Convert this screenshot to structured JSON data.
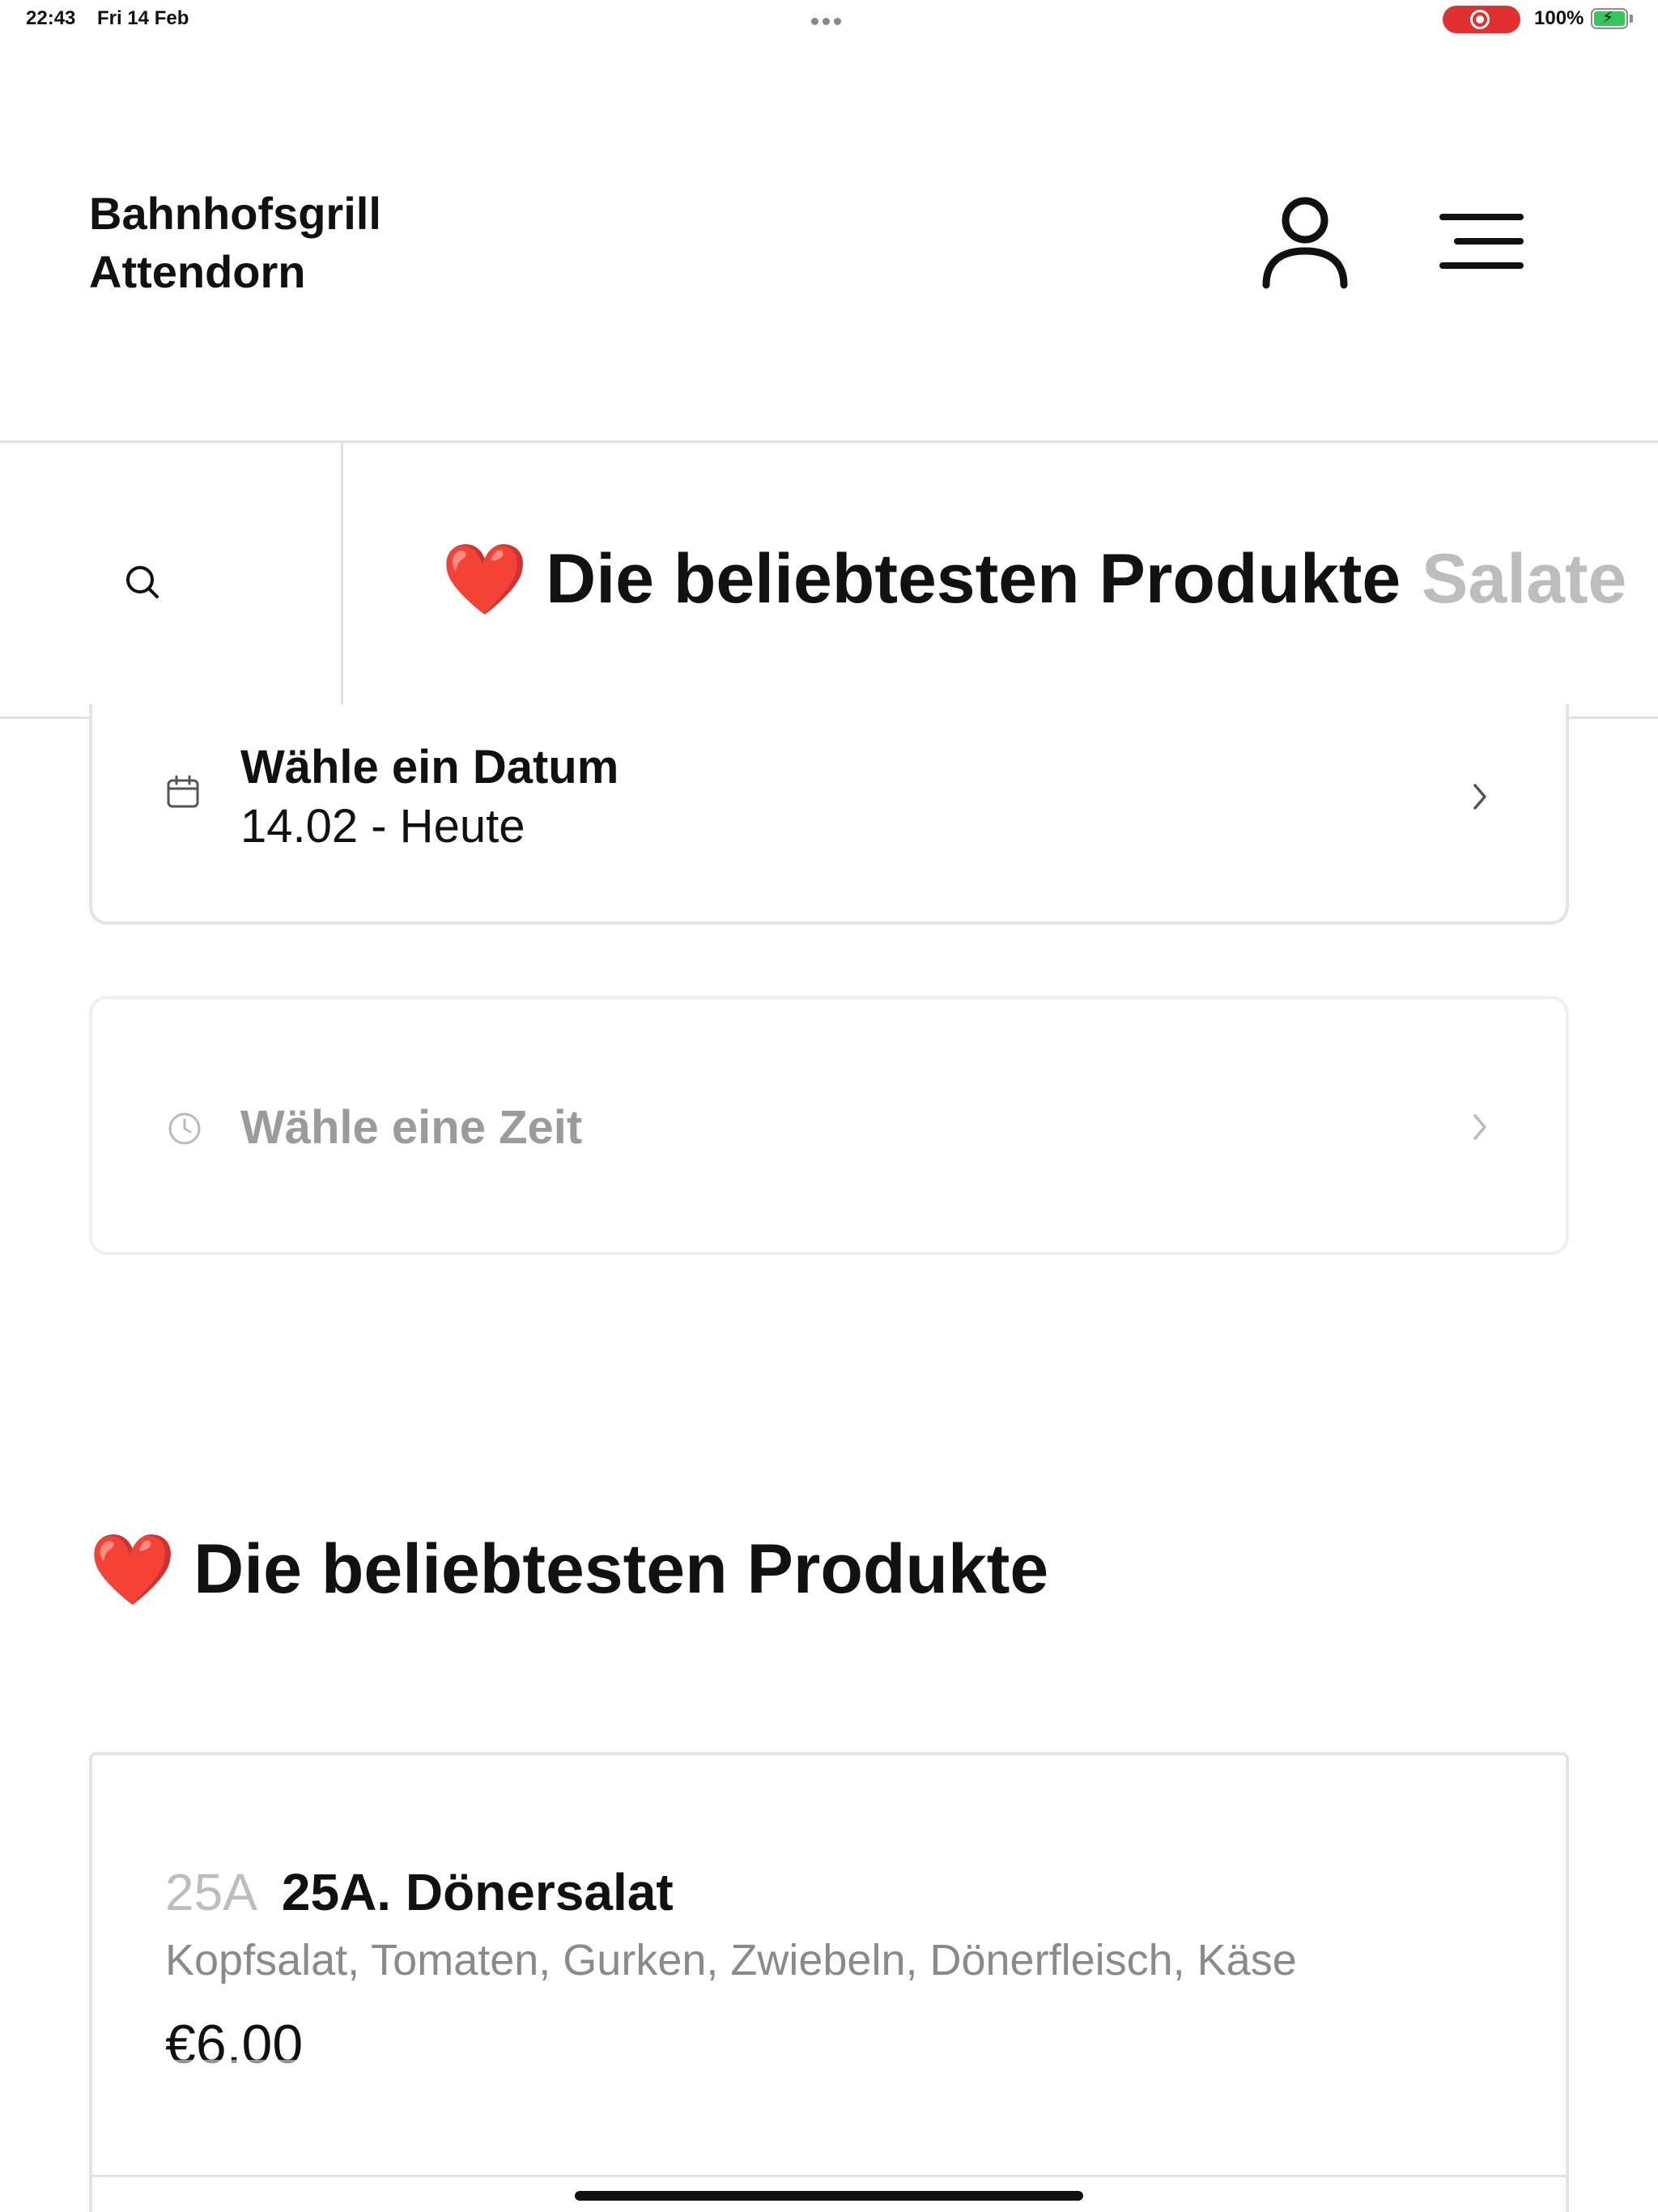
{
  "status_bar": {
    "time": "22:43",
    "date": "Fri 14 Feb",
    "battery": "100%",
    "recording_color": "#e0302f",
    "battery_color": "#34c759"
  },
  "header": {
    "store_name": "Bahnhofsgrill Attendorn",
    "account_icon": "user-icon",
    "menu_icon": "hamburger-menu-icon"
  },
  "category_bar": {
    "search_icon": "search-icon",
    "tabs": [
      {
        "emoji": "❤️",
        "label": "Die beliebtesten Produkte",
        "active": true
      },
      {
        "emoji": "",
        "label": "Salate",
        "active": false
      }
    ]
  },
  "date_picker": {
    "icon": "calendar-icon",
    "title": "Wähle ein Datum",
    "value": "14.02 - Heute"
  },
  "time_picker": {
    "icon": "clock-icon",
    "label": "Wähle eine Zeit"
  },
  "section": {
    "emoji": "❤️",
    "title": "Die beliebtesten Produkte"
  },
  "products": [
    {
      "number": "25A",
      "name": "25A. Dönersalat",
      "description": "Kopfsalat, Tomaten, Gurken, Zwiebeln, Dönerfleisch, Käse",
      "price": "€6.00"
    }
  ],
  "colors": {
    "text": "#111111",
    "muted": "#9b9b9b",
    "border": "#e3e3e3",
    "inactive_tab": "#bdbdbd"
  }
}
